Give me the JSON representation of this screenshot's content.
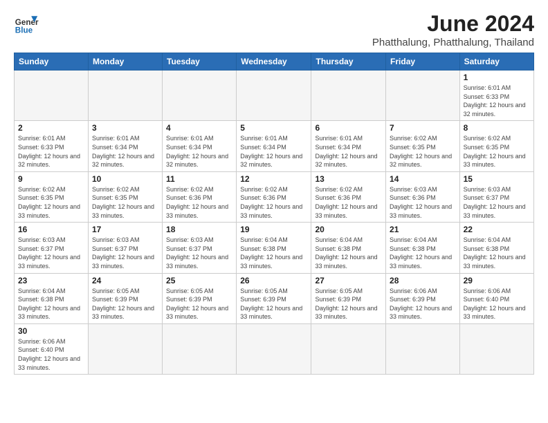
{
  "header": {
    "logo_text_regular": "General",
    "logo_text_blue": "Blue",
    "month_year": "June 2024",
    "location": "Phatthalung, Phatthalung, Thailand"
  },
  "weekdays": [
    "Sunday",
    "Monday",
    "Tuesday",
    "Wednesday",
    "Thursday",
    "Friday",
    "Saturday"
  ],
  "weeks": [
    [
      {
        "day": null
      },
      {
        "day": null
      },
      {
        "day": null
      },
      {
        "day": null
      },
      {
        "day": null
      },
      {
        "day": null
      },
      {
        "day": 1,
        "sunrise": "6:01 AM",
        "sunset": "6:33 PM",
        "daylight": "12 hours and 32 minutes."
      }
    ],
    [
      {
        "day": 2,
        "sunrise": "6:01 AM",
        "sunset": "6:33 PM",
        "daylight": "12 hours and 32 minutes."
      },
      {
        "day": 3,
        "sunrise": "6:01 AM",
        "sunset": "6:34 PM",
        "daylight": "12 hours and 32 minutes."
      },
      {
        "day": 4,
        "sunrise": "6:01 AM",
        "sunset": "6:34 PM",
        "daylight": "12 hours and 32 minutes."
      },
      {
        "day": 5,
        "sunrise": "6:01 AM",
        "sunset": "6:34 PM",
        "daylight": "12 hours and 32 minutes."
      },
      {
        "day": 6,
        "sunrise": "6:01 AM",
        "sunset": "6:34 PM",
        "daylight": "12 hours and 32 minutes."
      },
      {
        "day": 7,
        "sunrise": "6:02 AM",
        "sunset": "6:35 PM",
        "daylight": "12 hours and 32 minutes."
      },
      {
        "day": 8,
        "sunrise": "6:02 AM",
        "sunset": "6:35 PM",
        "daylight": "12 hours and 33 minutes."
      }
    ],
    [
      {
        "day": 9,
        "sunrise": "6:02 AM",
        "sunset": "6:35 PM",
        "daylight": "12 hours and 33 minutes."
      },
      {
        "day": 10,
        "sunrise": "6:02 AM",
        "sunset": "6:35 PM",
        "daylight": "12 hours and 33 minutes."
      },
      {
        "day": 11,
        "sunrise": "6:02 AM",
        "sunset": "6:36 PM",
        "daylight": "12 hours and 33 minutes."
      },
      {
        "day": 12,
        "sunrise": "6:02 AM",
        "sunset": "6:36 PM",
        "daylight": "12 hours and 33 minutes."
      },
      {
        "day": 13,
        "sunrise": "6:02 AM",
        "sunset": "6:36 PM",
        "daylight": "12 hours and 33 minutes."
      },
      {
        "day": 14,
        "sunrise": "6:03 AM",
        "sunset": "6:36 PM",
        "daylight": "12 hours and 33 minutes."
      },
      {
        "day": 15,
        "sunrise": "6:03 AM",
        "sunset": "6:37 PM",
        "daylight": "12 hours and 33 minutes."
      }
    ],
    [
      {
        "day": 16,
        "sunrise": "6:03 AM",
        "sunset": "6:37 PM",
        "daylight": "12 hours and 33 minutes."
      },
      {
        "day": 17,
        "sunrise": "6:03 AM",
        "sunset": "6:37 PM",
        "daylight": "12 hours and 33 minutes."
      },
      {
        "day": 18,
        "sunrise": "6:03 AM",
        "sunset": "6:37 PM",
        "daylight": "12 hours and 33 minutes."
      },
      {
        "day": 19,
        "sunrise": "6:04 AM",
        "sunset": "6:38 PM",
        "daylight": "12 hours and 33 minutes."
      },
      {
        "day": 20,
        "sunrise": "6:04 AM",
        "sunset": "6:38 PM",
        "daylight": "12 hours and 33 minutes."
      },
      {
        "day": 21,
        "sunrise": "6:04 AM",
        "sunset": "6:38 PM",
        "daylight": "12 hours and 33 minutes."
      },
      {
        "day": 22,
        "sunrise": "6:04 AM",
        "sunset": "6:38 PM",
        "daylight": "12 hours and 33 minutes."
      }
    ],
    [
      {
        "day": 23,
        "sunrise": "6:04 AM",
        "sunset": "6:38 PM",
        "daylight": "12 hours and 33 minutes."
      },
      {
        "day": 24,
        "sunrise": "6:05 AM",
        "sunset": "6:39 PM",
        "daylight": "12 hours and 33 minutes."
      },
      {
        "day": 25,
        "sunrise": "6:05 AM",
        "sunset": "6:39 PM",
        "daylight": "12 hours and 33 minutes."
      },
      {
        "day": 26,
        "sunrise": "6:05 AM",
        "sunset": "6:39 PM",
        "daylight": "12 hours and 33 minutes."
      },
      {
        "day": 27,
        "sunrise": "6:05 AM",
        "sunset": "6:39 PM",
        "daylight": "12 hours and 33 minutes."
      },
      {
        "day": 28,
        "sunrise": "6:06 AM",
        "sunset": "6:39 PM",
        "daylight": "12 hours and 33 minutes."
      },
      {
        "day": 29,
        "sunrise": "6:06 AM",
        "sunset": "6:40 PM",
        "daylight": "12 hours and 33 minutes."
      }
    ],
    [
      {
        "day": 30,
        "sunrise": "6:06 AM",
        "sunset": "6:40 PM",
        "daylight": "12 hours and 33 minutes."
      },
      {
        "day": null
      },
      {
        "day": null
      },
      {
        "day": null
      },
      {
        "day": null
      },
      {
        "day": null
      },
      {
        "day": null
      }
    ]
  ]
}
